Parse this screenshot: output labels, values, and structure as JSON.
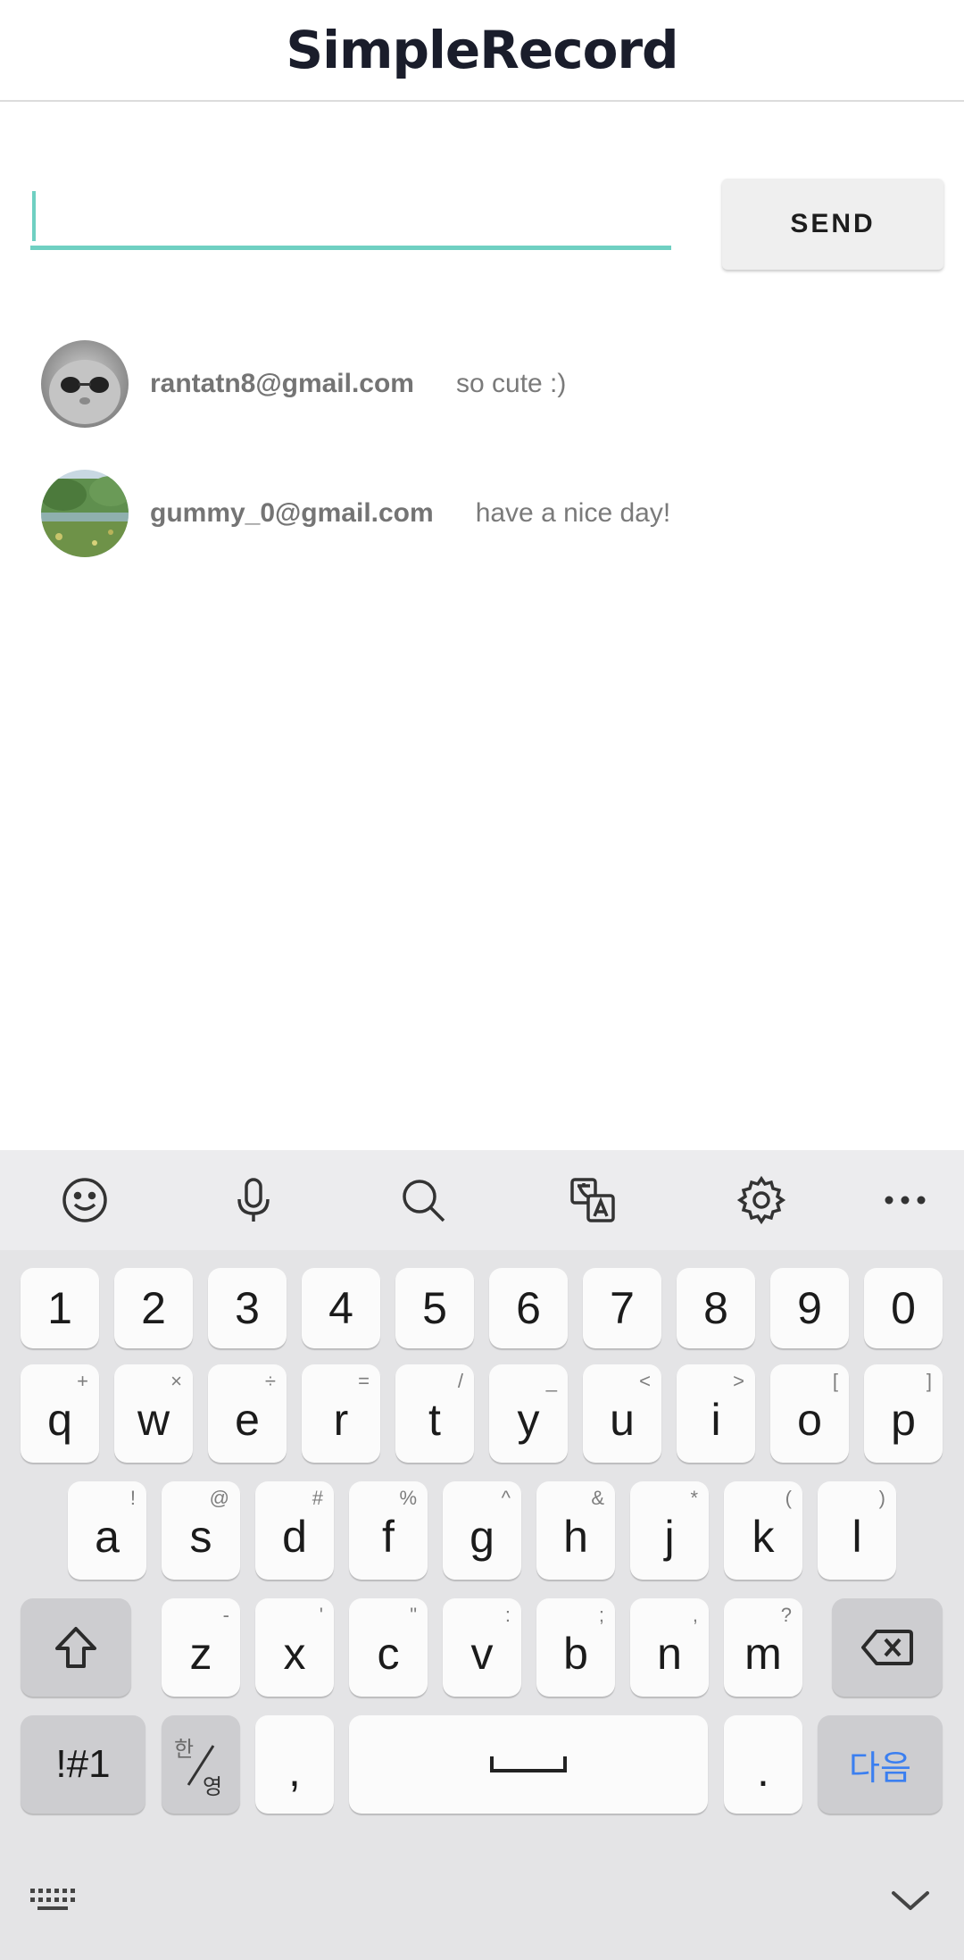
{
  "app": {
    "title": "SimpleRecord"
  },
  "composer": {
    "input_value": "",
    "send_label": "SEND"
  },
  "records": [
    {
      "email": "rantatn8@gmail.com",
      "message": "so cute :)"
    },
    {
      "email": "gummy_0@gmail.com",
      "message": "have a nice day!"
    }
  ],
  "keyboard": {
    "toolbar_icons": [
      "emoji-icon",
      "microphone-icon",
      "search-icon",
      "translate-icon",
      "settings-icon",
      "more-icon"
    ],
    "number_row": [
      "1",
      "2",
      "3",
      "4",
      "5",
      "6",
      "7",
      "8",
      "9",
      "0"
    ],
    "row1": [
      {
        "key": "q",
        "hint": "+"
      },
      {
        "key": "w",
        "hint": "×"
      },
      {
        "key": "e",
        "hint": "÷"
      },
      {
        "key": "r",
        "hint": "="
      },
      {
        "key": "t",
        "hint": "/"
      },
      {
        "key": "y",
        "hint": "_"
      },
      {
        "key": "u",
        "hint": "<"
      },
      {
        "key": "i",
        "hint": ">"
      },
      {
        "key": "o",
        "hint": "["
      },
      {
        "key": "p",
        "hint": "]"
      }
    ],
    "row2": [
      {
        "key": "a",
        "hint": "!"
      },
      {
        "key": "s",
        "hint": "@"
      },
      {
        "key": "d",
        "hint": "#"
      },
      {
        "key": "f",
        "hint": "%"
      },
      {
        "key": "g",
        "hint": "^"
      },
      {
        "key": "h",
        "hint": "&"
      },
      {
        "key": "j",
        "hint": "*"
      },
      {
        "key": "k",
        "hint": "("
      },
      {
        "key": "l",
        "hint": ")"
      }
    ],
    "row3": [
      {
        "key": "z",
        "hint": "-"
      },
      {
        "key": "x",
        "hint": "'"
      },
      {
        "key": "c",
        "hint": "\""
      },
      {
        "key": "v",
        "hint": ":"
      },
      {
        "key": "b",
        "hint": ";"
      },
      {
        "key": "n",
        "hint": ","
      },
      {
        "key": "m",
        "hint": "?"
      }
    ],
    "symbols_label": "!#1",
    "lang_top": "한",
    "lang_bottom": "영",
    "comma": ",",
    "period": ".",
    "next_label": "다음"
  }
}
